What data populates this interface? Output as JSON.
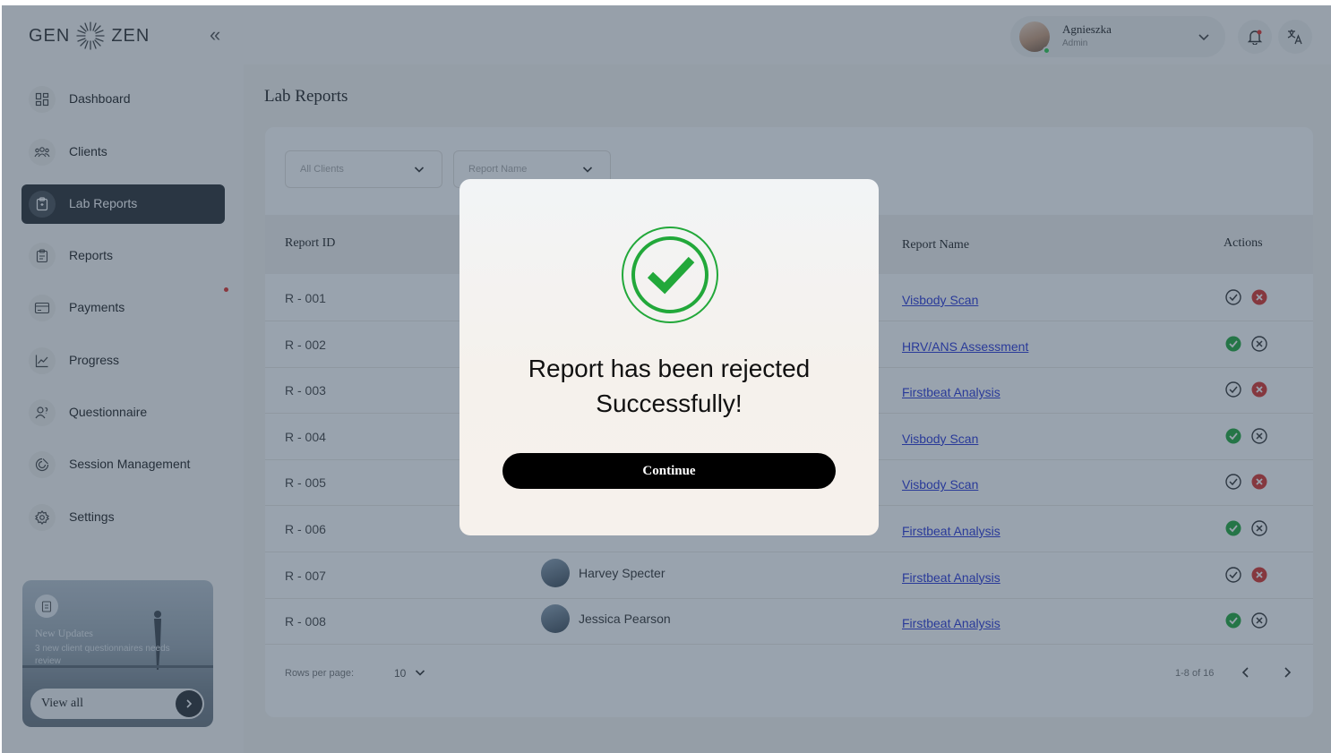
{
  "header": {
    "logo_left": "GEN",
    "logo_right": "ZEN",
    "user_name": "Agnieszka",
    "user_role": "Admin"
  },
  "sidebar": {
    "items": [
      {
        "label": "Dashboard",
        "icon": "grid-icon"
      },
      {
        "label": "Clients",
        "icon": "users-icon"
      },
      {
        "label": "Lab Reports",
        "icon": "clipboard-icon",
        "active": true
      },
      {
        "label": "Reports",
        "icon": "report-icon"
      },
      {
        "label": "Payments",
        "icon": "card-icon"
      },
      {
        "label": "Progress",
        "icon": "chart-icon"
      },
      {
        "label": "Questionnaire",
        "icon": "user-question-icon"
      },
      {
        "label": "Session Management",
        "icon": "session-icon"
      },
      {
        "label": "Settings",
        "icon": "gear-icon"
      }
    ],
    "promo": {
      "title": "New Updates",
      "text": "3 new client questionnaires needs review",
      "button": "View all"
    }
  },
  "main": {
    "title": "Lab Reports",
    "filters": {
      "clients_placeholder": "All Clients",
      "report_placeholder": "Report Name"
    },
    "columns": {
      "id": "Report ID",
      "report": "Report Name",
      "actions": "Actions"
    },
    "rows": [
      {
        "id": "R - 001",
        "client": "",
        "report": "Visbody Scan",
        "approved": false
      },
      {
        "id": "R - 002",
        "client": "",
        "report": "HRV/ANS Assessment",
        "approved": true
      },
      {
        "id": "R - 003",
        "client": "",
        "report": "Firstbeat Analysis",
        "approved": false
      },
      {
        "id": "R - 004",
        "client": "",
        "report": "Visbody Scan",
        "approved": true
      },
      {
        "id": "R - 005",
        "client": "",
        "report": "Visbody Scan",
        "approved": false
      },
      {
        "id": "R - 006",
        "client": "",
        "report": "Firstbeat Analysis",
        "approved": true
      },
      {
        "id": "R - 007",
        "client": "Harvey Specter",
        "report": "Firstbeat Analysis",
        "approved": false
      },
      {
        "id": "R - 008",
        "client": "Jessica Pearson",
        "report": "Firstbeat Analysis",
        "approved": true
      }
    ],
    "pagination": {
      "rows_label": "Rows per page:",
      "rows_value": "10",
      "range": "1-8 of 16"
    }
  },
  "modal": {
    "title_line1": "Report has been rejected",
    "title_line2": "Successfully!",
    "button": "Continue"
  },
  "colors": {
    "accent_dark": "#2b2f33",
    "success_green": "#22a83a",
    "reject_red": "#d9322b",
    "link_blue": "#2a36d6",
    "overlay": "#2a3e56"
  }
}
